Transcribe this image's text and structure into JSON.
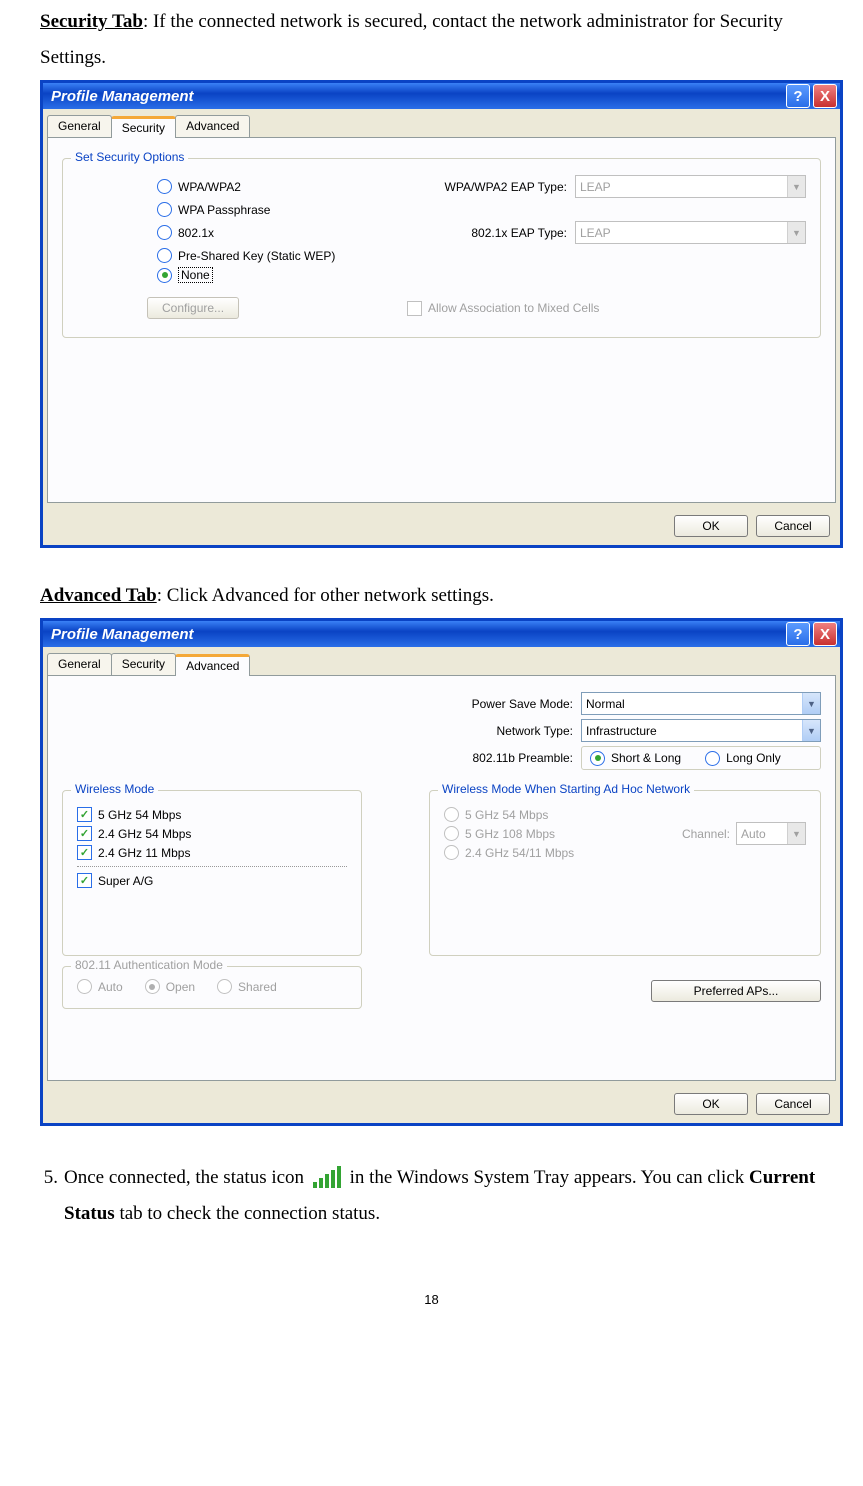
{
  "section1": {
    "title": "Security Tab",
    "desc": ": If the connected network is secured, contact the network administrator for Security Settings."
  },
  "dlg": {
    "title": "Profile Management",
    "tabs": {
      "general": "General",
      "security": "Security",
      "advanced": "Advanced"
    }
  },
  "sec": {
    "group_title": "Set Security Options",
    "opt_wpa": "WPA/WPA2",
    "opt_wpa_pass": "WPA Passphrase",
    "opt_8021x": "802.1x",
    "opt_psk": "Pre-Shared Key (Static WEP)",
    "opt_none": "None",
    "eap1_label": "WPA/WPA2 EAP Type:",
    "eap1_val": "LEAP",
    "eap2_label": "802.1x EAP Type:",
    "eap2_val": "LEAP",
    "configure": "Configure...",
    "mixed": "Allow Association to Mixed Cells"
  },
  "buttons": {
    "ok": "OK",
    "cancel": "Cancel"
  },
  "section2": {
    "title": "Advanced Tab",
    "desc": ": Click Advanced for other network settings."
  },
  "adv": {
    "psm_label": "Power Save Mode:",
    "psm_val": "Normal",
    "net_label": "Network Type:",
    "net_val": "Infrastructure",
    "preamble_label": "802.11b Preamble:",
    "preamble_short": "Short & Long",
    "preamble_long": "Long Only",
    "wm_title": "Wireless Mode",
    "wm1": "5 GHz 54 Mbps",
    "wm2": "2.4 GHz 54 Mbps",
    "wm3": "2.4 GHz 11 Mbps",
    "wm_super": "Super A/G",
    "adhoc_title": "Wireless Mode When Starting Ad Hoc Network",
    "ah1": "5 GHz 54 Mbps",
    "ah2": "5 GHz 108 Mbps",
    "ah3": "2.4 GHz 54/11 Mbps",
    "channel_label": "Channel:",
    "channel_val": "Auto",
    "auth_title": "802.11 Authentication Mode",
    "auth_auto": "Auto",
    "auth_open": "Open",
    "auth_shared": "Shared",
    "pref_ap": "Preferred APs..."
  },
  "step5": {
    "num": "5.",
    "t1": "Once connected, the status icon ",
    "t2": " in the Windows System Tray appears. You can click ",
    "bold": "Current Status",
    "t3": " tab to check the connection status."
  },
  "pagenum": "18"
}
